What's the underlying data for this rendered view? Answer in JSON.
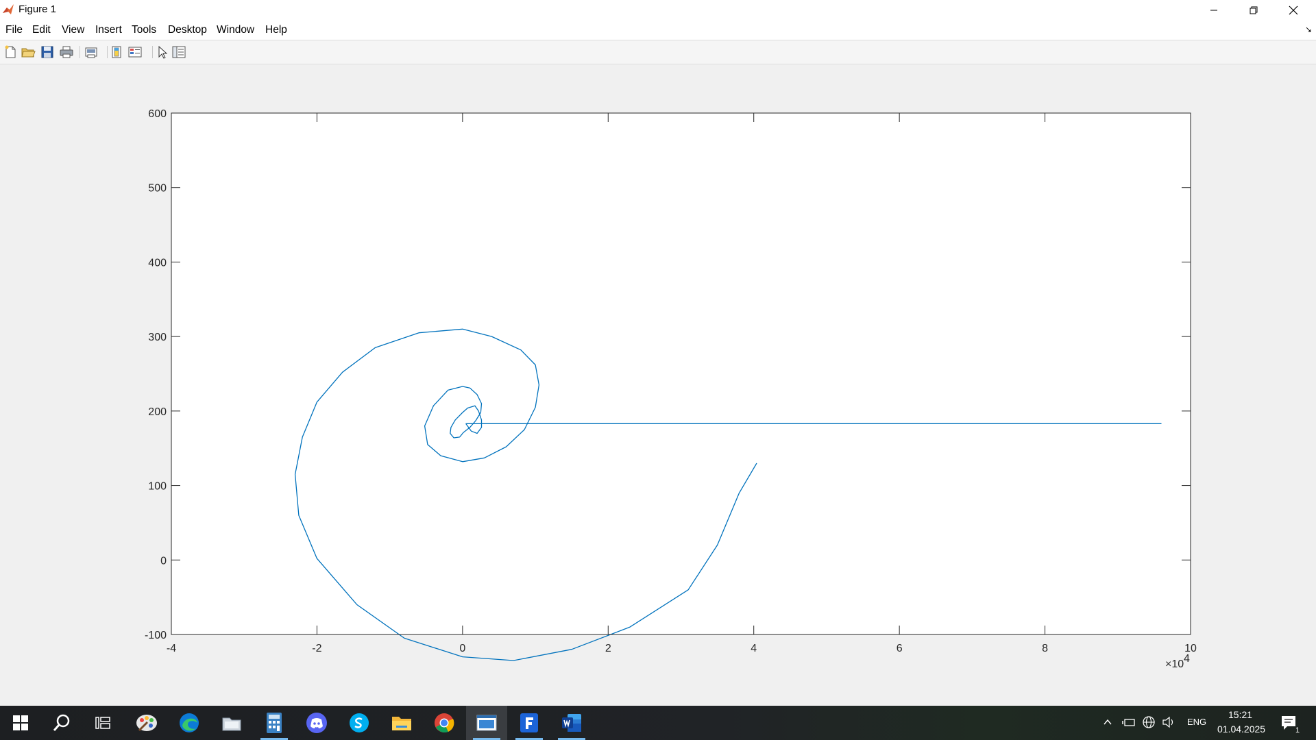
{
  "window": {
    "title": "Figure 1",
    "controls": [
      "minimize",
      "restore",
      "close"
    ]
  },
  "menubar": {
    "items": [
      "File",
      "Edit",
      "View",
      "Insert",
      "Tools",
      "Desktop",
      "Window",
      "Help"
    ]
  },
  "toolbar": {
    "buttons": [
      "new-figure-icon",
      "open-file-icon",
      "save-icon",
      "print-icon",
      "link-plot-icon",
      "colorbar-icon",
      "legend-icon",
      "pointer-icon",
      "property-inspector-icon"
    ]
  },
  "chart_data": {
    "type": "line",
    "title": "",
    "xlabel": "",
    "ylabel": "",
    "xlim": [
      -4,
      10
    ],
    "ylim": [
      -100,
      600
    ],
    "x_exponent": "×10",
    "x_exponent_power": "4",
    "xticks": [
      "-4",
      "-2",
      "0",
      "2",
      "4",
      "6",
      "8",
      "10"
    ],
    "yticks": [
      "-100",
      "0",
      "100",
      "200",
      "300",
      "400",
      "500",
      "600"
    ],
    "grid": false,
    "legend": false,
    "series": [
      {
        "color": "#0072bd",
        "x": [
          0.045,
          0.12,
          0.2,
          0.26,
          0.26,
          0.22,
          0.17,
          0.07,
          0.0,
          -0.1,
          -0.16,
          -0.17,
          -0.12,
          -0.04,
          0.01,
          0.1,
          0.18,
          0.25,
          0.26,
          0.2,
          0.1,
          0.0,
          -0.2,
          -0.4,
          -0.52,
          -0.48,
          -0.3,
          0.0,
          0.3,
          0.6,
          0.85,
          1.0,
          1.05,
          1.0,
          0.8,
          0.4,
          0.0,
          -0.6,
          -1.2,
          -1.65,
          -2.0,
          -2.2,
          -2.3,
          -2.25,
          -2.0,
          -1.45,
          -0.8,
          0.0,
          0.7,
          1.5,
          2.3,
          3.1,
          3.5,
          3.8,
          4.04
        ],
        "y": [
          183,
          173,
          170,
          178,
          188,
          200,
          207,
          204,
          198,
          188,
          178,
          170,
          164,
          165,
          171,
          178,
          187,
          198,
          210,
          222,
          231,
          233,
          228,
          207,
          180,
          155,
          140,
          132,
          137,
          152,
          175,
          205,
          235,
          262,
          282,
          300,
          310,
          305,
          285,
          252,
          212,
          165,
          115,
          60,
          2,
          -60,
          -105,
          -130,
          -135,
          -120,
          -90,
          -40,
          20,
          90,
          130
        ]
      },
      {
        "color": "#0072bd",
        "x": [
          0.045,
          9.6
        ],
        "y": [
          183,
          183
        ]
      }
    ]
  },
  "taskbar": {
    "apps": [
      "start-icon",
      "search-icon",
      "task-view-icon",
      "paint-icon",
      "edge-icon",
      "folder-app-icon",
      "calculator-icon",
      "discord-icon",
      "skype-icon",
      "file-explorer-icon",
      "chrome-icon",
      "matlab-figure-icon",
      "forms-icon",
      "word-icon"
    ],
    "tray": {
      "language": "ENG",
      "time": "15:21",
      "date": "01.04.2025",
      "notification_count": "1"
    }
  }
}
